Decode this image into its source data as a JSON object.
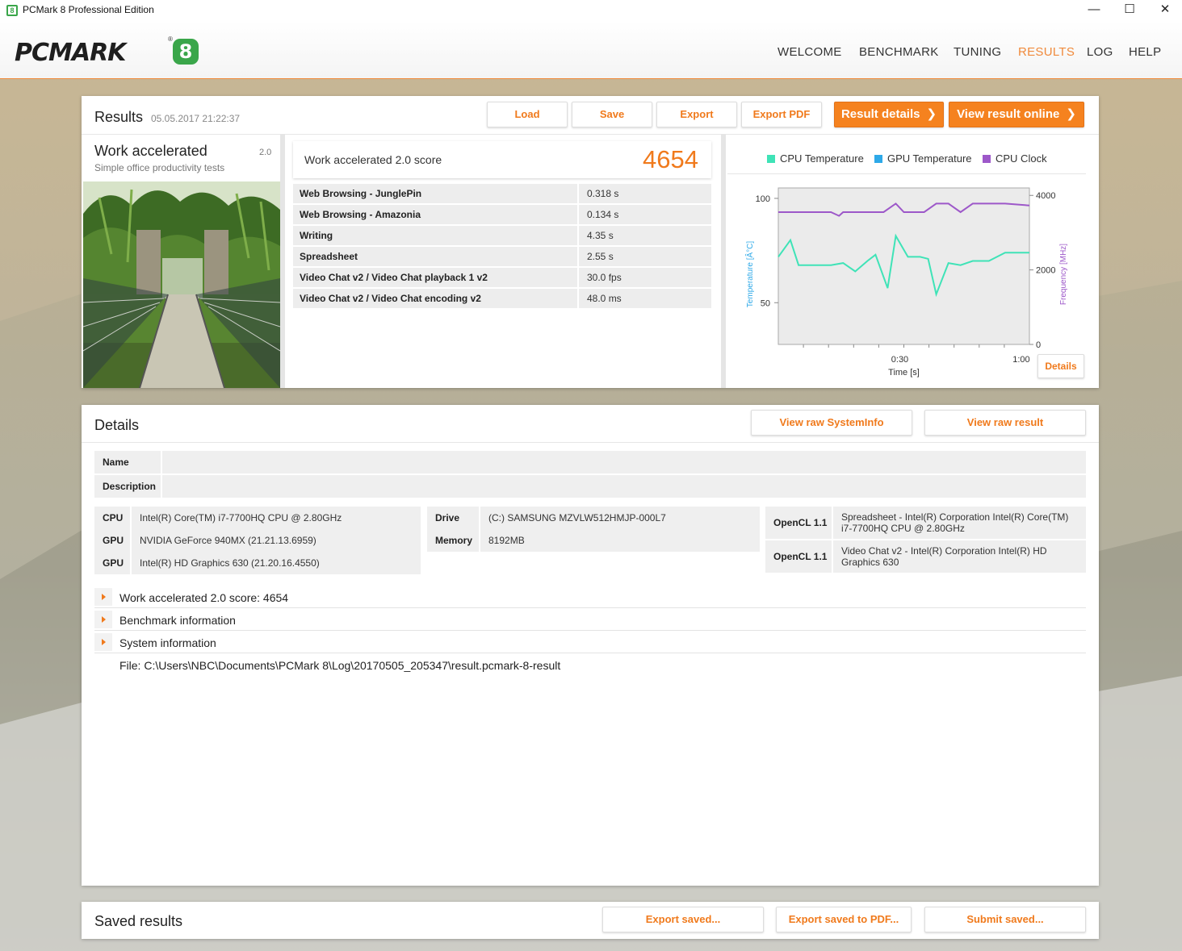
{
  "window": {
    "title": "PCMark 8 Professional Edition",
    "icon_label": "8",
    "controls": {
      "minimize": "—",
      "maximize": "☐",
      "close": "✕"
    }
  },
  "header": {
    "logo_text": "PCMARK",
    "logo_mark": "8",
    "logo_reg": "®",
    "nav": [
      "WELCOME",
      "BENCHMARK",
      "TUNING",
      "RESULTS",
      "LOG",
      "HELP"
    ],
    "active_nav": "RESULTS"
  },
  "colors": {
    "accent": "#f5821f",
    "cpu_temp": "#3fe3b7",
    "gpu_temp": "#2ea9e8",
    "cpu_clock": "#9d58c9",
    "logo_green": "#3aa64a"
  },
  "results": {
    "title": "Results",
    "date": "05.05.2017 21:22:37",
    "buttons": {
      "load": "Load",
      "save": "Save",
      "export": "Export",
      "export_pdf": "Export PDF",
      "result_details": "Result details",
      "view_online": "View result online",
      "chevron": "❯"
    },
    "benchmark": {
      "name": "Work accelerated",
      "version": "2.0",
      "subtitle": "Simple office productivity tests",
      "score_label": "Work accelerated 2.0 score",
      "score": "4654"
    },
    "metrics": [
      {
        "name": "Web Browsing - JunglePin",
        "value": "0.318 s"
      },
      {
        "name": "Web Browsing - Amazonia",
        "value": "0.134 s"
      },
      {
        "name": "Writing",
        "value": "4.35 s"
      },
      {
        "name": "Spreadsheet",
        "value": "2.55 s"
      },
      {
        "name": "Video Chat v2 / Video Chat playback 1 v2",
        "value": "30.0 fps"
      },
      {
        "name": "Video Chat v2 / Video Chat encoding v2",
        "value": "48.0 ms"
      }
    ],
    "chart_details_button": "Details"
  },
  "chart_data": {
    "type": "line",
    "legend": [
      "CPU Temperature",
      "GPU Temperature",
      "CPU Clock"
    ],
    "xlabel": "Time [s]",
    "ylabel_left": "Temperature [Â°C]",
    "ylabel_right": "Frequency [MHz]",
    "x_ticks": [
      "0:30",
      "1:00"
    ],
    "y_left_ticks": [
      "100",
      "50"
    ],
    "y_right_ticks": [
      "4000",
      "2000",
      "0"
    ],
    "xlim": [
      0,
      62
    ],
    "ylim_left": [
      30,
      105
    ],
    "ylim_right": [
      0,
      4200
    ],
    "series": [
      {
        "name": "CPU Temperature",
        "axis": "left",
        "x": [
          0,
          3,
          5,
          10,
          13,
          16,
          19,
          22,
          24,
          27,
          29,
          32,
          35,
          37,
          39,
          42,
          45,
          48,
          52,
          56,
          60,
          62
        ],
        "y": [
          72,
          80,
          68,
          68,
          68,
          69,
          65,
          70,
          73,
          57,
          82,
          72,
          72,
          71,
          54,
          69,
          68,
          70,
          70,
          74,
          74,
          74
        ]
      },
      {
        "name": "CPU Clock",
        "axis": "right",
        "x": [
          0,
          5,
          10,
          13,
          15,
          16,
          18,
          20,
          23,
          26,
          29,
          31,
          33,
          36,
          39,
          42,
          45,
          48,
          50,
          53,
          56,
          62
        ],
        "y": [
          3550,
          3550,
          3550,
          3550,
          3450,
          3550,
          3550,
          3550,
          3550,
          3550,
          3780,
          3550,
          3550,
          3550,
          3780,
          3780,
          3550,
          3780,
          3780,
          3780,
          3780,
          3730
        ]
      }
    ]
  },
  "details": {
    "title": "Details",
    "buttons": {
      "raw_sysinfo": "View raw SystemInfo",
      "raw_result": "View raw result"
    },
    "name_label": "Name",
    "name_value": "",
    "description_label": "Description",
    "description_value": "",
    "system": [
      {
        "k": "CPU",
        "v": "Intel(R) Core(TM) i7-7700HQ CPU @ 2.80GHz"
      },
      {
        "k": "GPU",
        "v": "NVIDIA GeForce 940MX (21.21.13.6959)"
      },
      {
        "k": "GPU",
        "v": "Intel(R) HD Graphics 630 (21.20.16.4550)"
      }
    ],
    "storage": [
      {
        "k": "Drive",
        "v": "(C:) SAMSUNG MZVLW512HMJP-000L7"
      },
      {
        "k": "Memory",
        "v": "8192MB"
      }
    ],
    "opencl": [
      {
        "k": "OpenCL 1.1",
        "v": "Spreadsheet - Intel(R) Corporation Intel(R) Core(TM) i7-7700HQ CPU @ 2.80GHz"
      },
      {
        "k": "OpenCL 1.1",
        "v": "Video Chat v2 - Intel(R) Corporation Intel(R) HD Graphics 630"
      }
    ],
    "expanders": [
      "Work accelerated 2.0 score: 4654",
      "Benchmark information",
      "System information"
    ],
    "file": "File: C:\\Users\\NBC\\Documents\\PCMark 8\\Log\\20170505_205347\\result.pcmark-8-result"
  },
  "saved": {
    "title": "Saved results",
    "buttons": {
      "export_saved": "Export saved...",
      "export_saved_pdf": "Export saved to PDF...",
      "submit_saved": "Submit saved..."
    }
  }
}
